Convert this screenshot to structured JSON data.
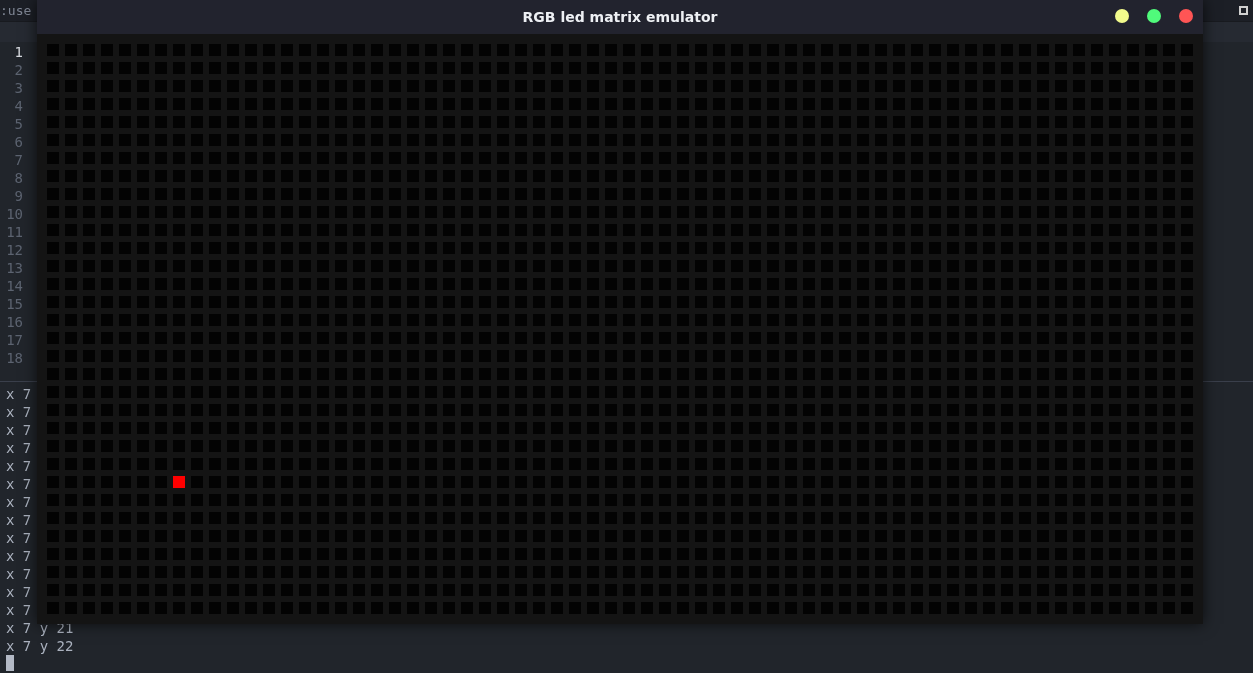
{
  "editor": {
    "title": ":use",
    "line_numbers": [
      {
        "number": "1",
        "current": true
      },
      {
        "number": "2",
        "current": false
      },
      {
        "number": "3",
        "current": false
      },
      {
        "number": "4",
        "current": false
      },
      {
        "number": "5",
        "current": false
      },
      {
        "number": "6",
        "current": false
      },
      {
        "number": "7",
        "current": false
      },
      {
        "number": "8",
        "current": false
      },
      {
        "number": "9",
        "current": false
      },
      {
        "number": "10",
        "current": false
      },
      {
        "number": "11",
        "current": false
      },
      {
        "number": "12",
        "current": false
      },
      {
        "number": "13",
        "current": false
      },
      {
        "number": "14",
        "current": false
      },
      {
        "number": "15",
        "current": false
      },
      {
        "number": "16",
        "current": false
      },
      {
        "number": "17",
        "current": false
      },
      {
        "number": "18",
        "current": false
      }
    ]
  },
  "terminal": {
    "lines": [
      "x 7",
      "x 7",
      "x 7",
      "x 7",
      "x 7",
      "x 7",
      "x 7",
      "x 7",
      "x 7",
      "x 7",
      "x 7",
      "x 7",
      "x 7",
      "x 7 y 21",
      "x 7 y 22"
    ]
  },
  "emulator_window": {
    "title": "RGB led matrix emulator",
    "buttons": [
      {
        "color": "#f1fa8c"
      },
      {
        "color": "#50fa7b"
      },
      {
        "color": "#ff5555"
      }
    ],
    "matrix": {
      "color": "#ff0000",
      "rows": [
        [
          false,
          false,
          false,
          false,
          false,
          false,
          false,
          false,
          false,
          false,
          false,
          false,
          false,
          false,
          false,
          false,
          false,
          false,
          false,
          false,
          false,
          false,
          false,
          false,
          false,
          false,
          false,
          false,
          false,
          false,
          false,
          false,
          false,
          false,
          false,
          false,
          false,
          false,
          false,
          false,
          false,
          false,
          false,
          false,
          false,
          false,
          false,
          false,
          false,
          false,
          false,
          false,
          false,
          false,
          false,
          false,
          false,
          false,
          false,
          false,
          false,
          false,
          false,
          false
        ],
        [
          false,
          false,
          false,
          false,
          false,
          false,
          false,
          false,
          false,
          false,
          false,
          false,
          false,
          false,
          false,
          false,
          false,
          false,
          false,
          false,
          false,
          false,
          false,
          false,
          false,
          false,
          false,
          false,
          false,
          false,
          false,
          false,
          false,
          false,
          false,
          false,
          false,
          false,
          false,
          false,
          false,
          false,
          false,
          false,
          false,
          false,
          false,
          false,
          false,
          false,
          false,
          false,
          false,
          false,
          false,
          false,
          false,
          false,
          false,
          false,
          false,
          false,
          false,
          false
        ],
        [
          false,
          false,
          false,
          false,
          false,
          false,
          false,
          false,
          false,
          false,
          false,
          false,
          false,
          false,
          false,
          false,
          false,
          false,
          false,
          false,
          false,
          false,
          false,
          false,
          false,
          false,
          false,
          false,
          false,
          false,
          false,
          false,
          false,
          false,
          false,
          false,
          false,
          false,
          false,
          false,
          false,
          false,
          false,
          false,
          false,
          false,
          false,
          false,
          false,
          false,
          false,
          false,
          false,
          false,
          false,
          false,
          false,
          false,
          false,
          false,
          false,
          false,
          false,
          false
        ],
        [
          false,
          false,
          false,
          false,
          false,
          false,
          false,
          false,
          false,
          false,
          false,
          false,
          false,
          false,
          false,
          false,
          false,
          false,
          false,
          false,
          false,
          false,
          false,
          false,
          false,
          false,
          false,
          false,
          false,
          false,
          false,
          false,
          false,
          false,
          false,
          false,
          false,
          false,
          false,
          false,
          false,
          false,
          false,
          false,
          false,
          false,
          false,
          false,
          false,
          false,
          false,
          false,
          false,
          false,
          false,
          false,
          false,
          false,
          false,
          false,
          false,
          false,
          false,
          false
        ],
        [
          false,
          false,
          false,
          false,
          false,
          false,
          false,
          false,
          false,
          false,
          false,
          false,
          false,
          false,
          false,
          false,
          false,
          false,
          false,
          false,
          false,
          false,
          false,
          false,
          false,
          false,
          false,
          false,
          false,
          false,
          false,
          false,
          false,
          false,
          false,
          false,
          false,
          false,
          false,
          false,
          false,
          false,
          false,
          false,
          false,
          false,
          false,
          false,
          false,
          false,
          false,
          false,
          false,
          false,
          false,
          false,
          false,
          false,
          false,
          false,
          false,
          false,
          false,
          false
        ],
        [
          false,
          false,
          false,
          false,
          false,
          false,
          false,
          false,
          false,
          false,
          false,
          false,
          false,
          false,
          false,
          false,
          false,
          false,
          false,
          false,
          false,
          false,
          false,
          false,
          false,
          false,
          false,
          false,
          false,
          false,
          false,
          false,
          false,
          false,
          false,
          false,
          false,
          false,
          false,
          false,
          false,
          false,
          false,
          false,
          false,
          false,
          false,
          false,
          false,
          false,
          false,
          false,
          false,
          false,
          false,
          false,
          false,
          false,
          false,
          false,
          false,
          false,
          false,
          false
        ],
        [
          false,
          false,
          false,
          false,
          false,
          false,
          false,
          false,
          false,
          false,
          false,
          false,
          false,
          false,
          false,
          false,
          false,
          false,
          false,
          false,
          false,
          false,
          false,
          false,
          false,
          false,
          false,
          false,
          false,
          false,
          false,
          false,
          false,
          false,
          false,
          false,
          false,
          false,
          false,
          false,
          false,
          false,
          false,
          false,
          false,
          false,
          false,
          false,
          false,
          false,
          false,
          false,
          false,
          false,
          false,
          false,
          false,
          false,
          false,
          false,
          false,
          false,
          false,
          false
        ],
        [
          false,
          false,
          false,
          false,
          false,
          false,
          false,
          false,
          false,
          false,
          false,
          false,
          false,
          false,
          false,
          false,
          false,
          false,
          false,
          false,
          false,
          false,
          false,
          false,
          false,
          false,
          false,
          false,
          false,
          false,
          false,
          false,
          false,
          false,
          false,
          false,
          false,
          false,
          false,
          false,
          false,
          false,
          false,
          false,
          false,
          false,
          false,
          false,
          false,
          false,
          false,
          false,
          false,
          false,
          false,
          false,
          false,
          false,
          false,
          false,
          false,
          false,
          false,
          false
        ],
        [
          false,
          false,
          false,
          false,
          false,
          false,
          false,
          false,
          false,
          false,
          false,
          false,
          false,
          false,
          false,
          false,
          false,
          false,
          false,
          false,
          false,
          false,
          false,
          false,
          false,
          false,
          false,
          false,
          false,
          false,
          false,
          false,
          false,
          false,
          false,
          false,
          false,
          false,
          false,
          false,
          false,
          false,
          false,
          false,
          false,
          false,
          false,
          false,
          false,
          false,
          false,
          false,
          false,
          false,
          false,
          false,
          false,
          false,
          false,
          false,
          false,
          false,
          false,
          false
        ],
        [
          false,
          false,
          false,
          false,
          false,
          false,
          false,
          false,
          false,
          false,
          false,
          false,
          false,
          false,
          false,
          false,
          false,
          false,
          false,
          false,
          false,
          false,
          false,
          false,
          false,
          false,
          false,
          false,
          false,
          false,
          false,
          false,
          false,
          false,
          false,
          false,
          false,
          false,
          false,
          false,
          false,
          false,
          false,
          false,
          false,
          false,
          false,
          false,
          false,
          false,
          false,
          false,
          false,
          false,
          false,
          false,
          false,
          false,
          false,
          false,
          false,
          false,
          false,
          false
        ],
        [
          false,
          false,
          false,
          false,
          false,
          false,
          false,
          false,
          false,
          false,
          false,
          false,
          false,
          false,
          false,
          false,
          false,
          false,
          false,
          false,
          false,
          false,
          false,
          false,
          false,
          false,
          false,
          false,
          false,
          false,
          false,
          false,
          false,
          false,
          false,
          false,
          false,
          false,
          false,
          false,
          false,
          false,
          false,
          false,
          false,
          false,
          false,
          false,
          false,
          false,
          false,
          false,
          false,
          false,
          false,
          false,
          false,
          false,
          false,
          false,
          false,
          false,
          false,
          false
        ],
        [
          false,
          false,
          false,
          false,
          false,
          false,
          false,
          false,
          false,
          false,
          false,
          false,
          false,
          false,
          false,
          false,
          false,
          false,
          false,
          false,
          false,
          false,
          false,
          false,
          false,
          false,
          false,
          false,
          false,
          false,
          false,
          false,
          false,
          false,
          false,
          false,
          false,
          false,
          false,
          false,
          false,
          false,
          false,
          false,
          false,
          false,
          false,
          false,
          false,
          false,
          false,
          false,
          false,
          false,
          false,
          false,
          false,
          false,
          false,
          false,
          false,
          false,
          false,
          false
        ],
        [
          false,
          false,
          false,
          false,
          false,
          false,
          false,
          false,
          false,
          false,
          false,
          false,
          false,
          false,
          false,
          false,
          false,
          false,
          false,
          false,
          false,
          false,
          false,
          false,
          false,
          false,
          false,
          false,
          false,
          false,
          false,
          false,
          false,
          false,
          false,
          false,
          false,
          false,
          false,
          false,
          false,
          false,
          false,
          false,
          false,
          false,
          false,
          false,
          false,
          false,
          false,
          false,
          false,
          false,
          false,
          false,
          false,
          false,
          false,
          false,
          false,
          false,
          false,
          false
        ],
        [
          false,
          false,
          false,
          false,
          false,
          false,
          false,
          false,
          false,
          false,
          false,
          false,
          false,
          false,
          false,
          false,
          false,
          false,
          false,
          false,
          false,
          false,
          false,
          false,
          false,
          false,
          false,
          false,
          false,
          false,
          false,
          false,
          false,
          false,
          false,
          false,
          false,
          false,
          false,
          false,
          false,
          false,
          false,
          false,
          false,
          false,
          false,
          false,
          false,
          false,
          false,
          false,
          false,
          false,
          false,
          false,
          false,
          false,
          false,
          false,
          false,
          false,
          false,
          false
        ],
        [
          false,
          false,
          false,
          false,
          false,
          false,
          false,
          false,
          false,
          false,
          false,
          false,
          false,
          false,
          false,
          false,
          false,
          false,
          false,
          false,
          false,
          false,
          false,
          false,
          false,
          false,
          false,
          false,
          false,
          false,
          false,
          false,
          false,
          false,
          false,
          false,
          false,
          false,
          false,
          false,
          false,
          false,
          false,
          false,
          false,
          false,
          false,
          false,
          false,
          false,
          false,
          false,
          false,
          false,
          false,
          false,
          false,
          false,
          false,
          false,
          false,
          false,
          false,
          false
        ],
        [
          false,
          false,
          false,
          false,
          false,
          false,
          false,
          false,
          false,
          false,
          false,
          false,
          false,
          false,
          false,
          false,
          false,
          false,
          false,
          false,
          false,
          false,
          false,
          false,
          false,
          false,
          false,
          false,
          false,
          false,
          false,
          false,
          false,
          false,
          false,
          false,
          false,
          false,
          false,
          false,
          false,
          false,
          false,
          false,
          false,
          false,
          false,
          false,
          false,
          false,
          false,
          false,
          false,
          false,
          false,
          false,
          false,
          false,
          false,
          false,
          false,
          false,
          false,
          false
        ],
        [
          false,
          false,
          false,
          false,
          false,
          false,
          false,
          false,
          false,
          false,
          false,
          false,
          false,
          false,
          false,
          false,
          false,
          false,
          false,
          false,
          false,
          false,
          false,
          false,
          false,
          false,
          false,
          false,
          false,
          false,
          false,
          false,
          false,
          false,
          false,
          false,
          false,
          false,
          false,
          false,
          false,
          false,
          false,
          false,
          false,
          false,
          false,
          false,
          false,
          false,
          false,
          false,
          false,
          false,
          false,
          false,
          false,
          false,
          false,
          false,
          false,
          false,
          false,
          false
        ],
        [
          false,
          false,
          false,
          false,
          false,
          false,
          false,
          false,
          false,
          false,
          false,
          false,
          false,
          false,
          false,
          false,
          false,
          false,
          false,
          false,
          false,
          false,
          false,
          false,
          false,
          false,
          false,
          false,
          false,
          false,
          false,
          false,
          false,
          false,
          false,
          false,
          false,
          false,
          false,
          false,
          false,
          false,
          false,
          false,
          false,
          false,
          false,
          false,
          false,
          false,
          false,
          false,
          false,
          false,
          false,
          false,
          false,
          false,
          false,
          false,
          false,
          false,
          false,
          false
        ],
        [
          false,
          false,
          false,
          false,
          false,
          false,
          false,
          false,
          false,
          false,
          false,
          false,
          false,
          false,
          false,
          false,
          false,
          false,
          false,
          false,
          false,
          false,
          false,
          false,
          false,
          false,
          false,
          false,
          false,
          false,
          false,
          false,
          false,
          false,
          false,
          false,
          false,
          false,
          false,
          false,
          false,
          false,
          false,
          false,
          false,
          false,
          false,
          false,
          false,
          false,
          false,
          false,
          false,
          false,
          false,
          false,
          false,
          false,
          false,
          false,
          false,
          false,
          false,
          false
        ],
        [
          false,
          false,
          false,
          false,
          false,
          false,
          false,
          false,
          false,
          false,
          false,
          false,
          false,
          false,
          false,
          false,
          false,
          false,
          false,
          false,
          false,
          false,
          false,
          false,
          false,
          false,
          false,
          false,
          false,
          false,
          false,
          false,
          false,
          false,
          false,
          false,
          false,
          false,
          false,
          false,
          false,
          false,
          false,
          false,
          false,
          false,
          false,
          false,
          false,
          false,
          false,
          false,
          false,
          false,
          false,
          false,
          false,
          false,
          false,
          false,
          false,
          false,
          false,
          false
        ],
        [
          false,
          false,
          false,
          false,
          false,
          false,
          false,
          false,
          false,
          false,
          false,
          false,
          false,
          false,
          false,
          false,
          false,
          false,
          false,
          false,
          false,
          false,
          false,
          false,
          false,
          false,
          false,
          false,
          false,
          false,
          false,
          false,
          false,
          false,
          false,
          false,
          false,
          false,
          false,
          false,
          false,
          false,
          false,
          false,
          false,
          false,
          false,
          false,
          false,
          false,
          false,
          false,
          false,
          false,
          false,
          false,
          false,
          false,
          false,
          false,
          false,
          false,
          false,
          false
        ],
        [
          false,
          false,
          false,
          false,
          false,
          false,
          false,
          false,
          false,
          false,
          false,
          false,
          false,
          false,
          false,
          false,
          false,
          false,
          false,
          false,
          false,
          false,
          false,
          false,
          false,
          false,
          false,
          false,
          false,
          false,
          false,
          false,
          false,
          false,
          false,
          false,
          false,
          false,
          false,
          false,
          false,
          false,
          false,
          false,
          false,
          false,
          false,
          false,
          false,
          false,
          false,
          false,
          false,
          false,
          false,
          false,
          false,
          false,
          false,
          false,
          false,
          false,
          false,
          false
        ],
        [
          false,
          false,
          false,
          false,
          false,
          false,
          false,
          false,
          false,
          false,
          false,
          false,
          false,
          false,
          false,
          false,
          false,
          false,
          false,
          false,
          false,
          false,
          false,
          false,
          false,
          false,
          false,
          false,
          false,
          false,
          false,
          false,
          false,
          false,
          false,
          false,
          false,
          false,
          false,
          false,
          false,
          false,
          false,
          false,
          false,
          false,
          false,
          false,
          false,
          false,
          false,
          false,
          false,
          false,
          false,
          false,
          false,
          false,
          false,
          false,
          false,
          false,
          false,
          false
        ],
        [
          false,
          false,
          false,
          false,
          false,
          false,
          false,
          false,
          false,
          false,
          false,
          false,
          false,
          false,
          false,
          false,
          false,
          false,
          false,
          false,
          false,
          false,
          false,
          false,
          false,
          false,
          false,
          false,
          false,
          false,
          false,
          false,
          false,
          false,
          false,
          false,
          false,
          false,
          false,
          false,
          false,
          false,
          false,
          false,
          false,
          false,
          false,
          false,
          false,
          false,
          false,
          false,
          false,
          false,
          false,
          false,
          false,
          false,
          false,
          false,
          false,
          false,
          false,
          false
        ],
        [
          false,
          false,
          false,
          false,
          false,
          false,
          false,
          true,
          false,
          false,
          false,
          false,
          false,
          false,
          false,
          false,
          false,
          false,
          false,
          false,
          false,
          false,
          false,
          false,
          false,
          false,
          false,
          false,
          false,
          false,
          false,
          false,
          false,
          false,
          false,
          false,
          false,
          false,
          false,
          false,
          false,
          false,
          false,
          false,
          false,
          false,
          false,
          false,
          false,
          false,
          false,
          false,
          false,
          false,
          false,
          false,
          false,
          false,
          false,
          false,
          false,
          false,
          false,
          false
        ],
        [
          false,
          false,
          false,
          false,
          false,
          false,
          false,
          false,
          false,
          false,
          false,
          false,
          false,
          false,
          false,
          false,
          false,
          false,
          false,
          false,
          false,
          false,
          false,
          false,
          false,
          false,
          false,
          false,
          false,
          false,
          false,
          false,
          false,
          false,
          false,
          false,
          false,
          false,
          false,
          false,
          false,
          false,
          false,
          false,
          false,
          false,
          false,
          false,
          false,
          false,
          false,
          false,
          false,
          false,
          false,
          false,
          false,
          false,
          false,
          false,
          false,
          false,
          false,
          false
        ],
        [
          false,
          false,
          false,
          false,
          false,
          false,
          false,
          false,
          false,
          false,
          false,
          false,
          false,
          false,
          false,
          false,
          false,
          false,
          false,
          false,
          false,
          false,
          false,
          false,
          false,
          false,
          false,
          false,
          false,
          false,
          false,
          false,
          false,
          false,
          false,
          false,
          false,
          false,
          false,
          false,
          false,
          false,
          false,
          false,
          false,
          false,
          false,
          false,
          false,
          false,
          false,
          false,
          false,
          false,
          false,
          false,
          false,
          false,
          false,
          false,
          false,
          false,
          false,
          false
        ],
        [
          false,
          false,
          false,
          false,
          false,
          false,
          false,
          false,
          false,
          false,
          false,
          false,
          false,
          false,
          false,
          false,
          false,
          false,
          false,
          false,
          false,
          false,
          false,
          false,
          false,
          false,
          false,
          false,
          false,
          false,
          false,
          false,
          false,
          false,
          false,
          false,
          false,
          false,
          false,
          false,
          false,
          false,
          false,
          false,
          false,
          false,
          false,
          false,
          false,
          false,
          false,
          false,
          false,
          false,
          false,
          false,
          false,
          false,
          false,
          false,
          false,
          false,
          false,
          false
        ],
        [
          false,
          false,
          false,
          false,
          false,
          false,
          false,
          false,
          false,
          false,
          false,
          false,
          false,
          false,
          false,
          false,
          false,
          false,
          false,
          false,
          false,
          false,
          false,
          false,
          false,
          false,
          false,
          false,
          false,
          false,
          false,
          false,
          false,
          false,
          false,
          false,
          false,
          false,
          false,
          false,
          false,
          false,
          false,
          false,
          false,
          false,
          false,
          false,
          false,
          false,
          false,
          false,
          false,
          false,
          false,
          false,
          false,
          false,
          false,
          false,
          false,
          false,
          false,
          false
        ],
        [
          false,
          false,
          false,
          false,
          false,
          false,
          false,
          false,
          false,
          false,
          false,
          false,
          false,
          false,
          false,
          false,
          false,
          false,
          false,
          false,
          false,
          false,
          false,
          false,
          false,
          false,
          false,
          false,
          false,
          false,
          false,
          false,
          false,
          false,
          false,
          false,
          false,
          false,
          false,
          false,
          false,
          false,
          false,
          false,
          false,
          false,
          false,
          false,
          false,
          false,
          false,
          false,
          false,
          false,
          false,
          false,
          false,
          false,
          false,
          false,
          false,
          false,
          false,
          false
        ],
        [
          false,
          false,
          false,
          false,
          false,
          false,
          false,
          false,
          false,
          false,
          false,
          false,
          false,
          false,
          false,
          false,
          false,
          false,
          false,
          false,
          false,
          false,
          false,
          false,
          false,
          false,
          false,
          false,
          false,
          false,
          false,
          false,
          false,
          false,
          false,
          false,
          false,
          false,
          false,
          false,
          false,
          false,
          false,
          false,
          false,
          false,
          false,
          false,
          false,
          false,
          false,
          false,
          false,
          false,
          false,
          false,
          false,
          false,
          false,
          false,
          false,
          false,
          false,
          false
        ],
        [
          false,
          false,
          false,
          false,
          false,
          false,
          false,
          false,
          false,
          false,
          false,
          false,
          false,
          false,
          false,
          false,
          false,
          false,
          false,
          false,
          false,
          false,
          false,
          false,
          false,
          false,
          false,
          false,
          false,
          false,
          false,
          false,
          false,
          false,
          false,
          false,
          false,
          false,
          false,
          false,
          false,
          false,
          false,
          false,
          false,
          false,
          false,
          false,
          false,
          false,
          false,
          false,
          false,
          false,
          false,
          false,
          false,
          false,
          false,
          false,
          false,
          false,
          false,
          false
        ]
      ]
    }
  }
}
